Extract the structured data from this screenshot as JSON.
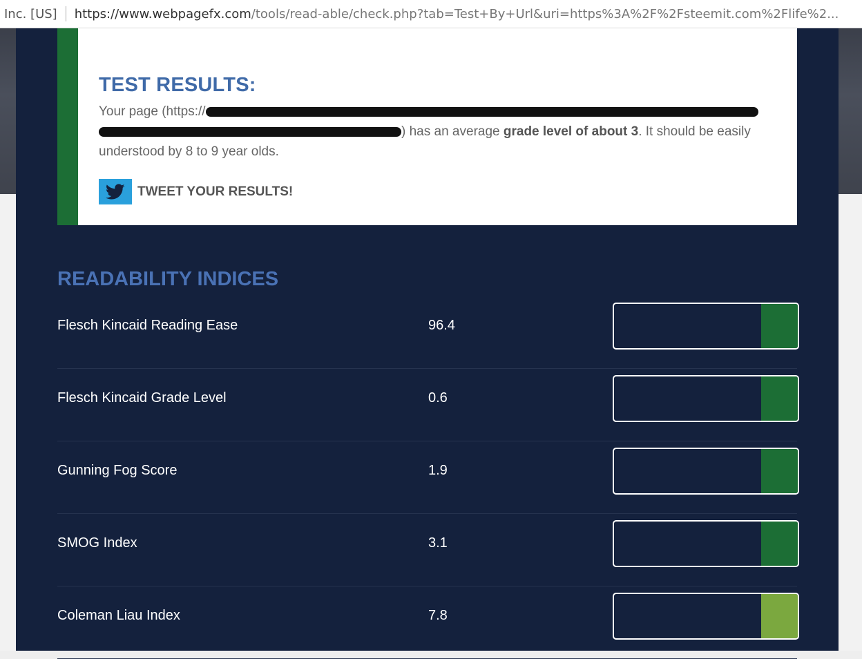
{
  "browser": {
    "site_label": "Inc. [US]",
    "url_host": "https://www.webpagefx.com",
    "url_path": "/tools/read-able/check.php?tab=Test+By+Url&uri=https%3A%2F%2Fsteemit.com%2Flife%2..."
  },
  "results": {
    "title": "TEST RESULTS:",
    "text_before": "Your page (https://",
    "text_mid": ") has an average ",
    "grade_phrase": "grade level of about 3",
    "text_after": ". It should be easily understood by 8 to 9 year olds.",
    "tweet_label": "TWEET YOUR RESULTS!",
    "tweet_icon": "twitter-bird-icon",
    "accent_color": "#1c6e35"
  },
  "indices": {
    "title": "READABILITY INDICES",
    "rows": [
      {
        "name": "Flesch Kincaid Reading Ease",
        "value": "96.4",
        "meter_color": "#1c6e35"
      },
      {
        "name": "Flesch Kincaid Grade Level",
        "value": "0.6",
        "meter_color": "#1c6e35"
      },
      {
        "name": "Gunning Fog Score",
        "value": "1.9",
        "meter_color": "#1c6e35"
      },
      {
        "name": "SMOG Index",
        "value": "3.1",
        "meter_color": "#1c6e35"
      },
      {
        "name": "Coleman Liau Index",
        "value": "7.8",
        "meter_color": "#7ba83f"
      }
    ]
  }
}
